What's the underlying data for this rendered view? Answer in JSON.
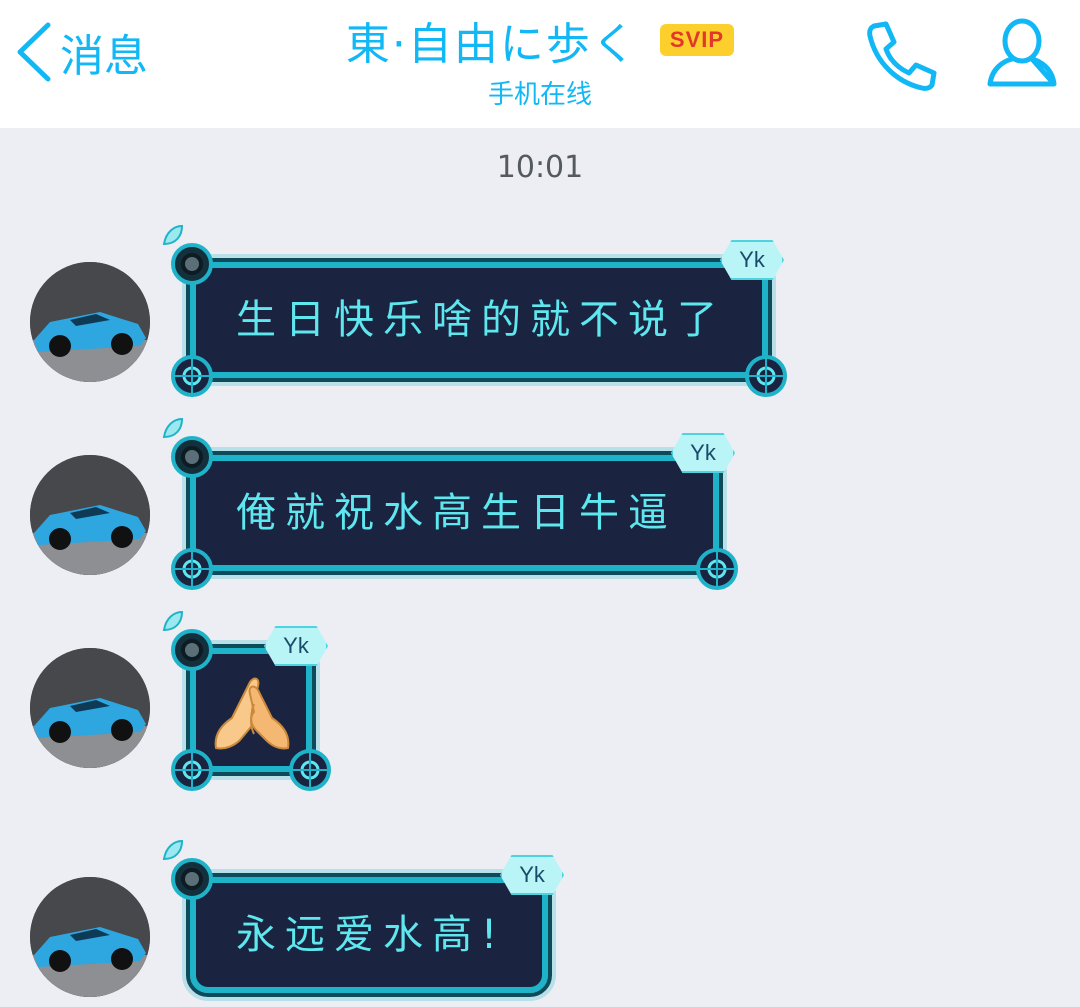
{
  "header": {
    "back_label": "消息",
    "title": "東·自由に歩く",
    "badge": "SVIP",
    "status": "手机在线"
  },
  "chat": {
    "timestamp": "10:01",
    "bubble_tag": "Yk",
    "messages": [
      {
        "type": "text",
        "text": "生日快乐啥的就不说了"
      },
      {
        "type": "text",
        "text": "俺就祝水高生日牛逼"
      },
      {
        "type": "emoji",
        "emoji": "folded-hands-emoji"
      },
      {
        "type": "text",
        "text": "永远爱水高!"
      }
    ]
  },
  "colors": {
    "accent": "#12b7f5",
    "bubble_bg": "#1a2440",
    "bubble_border": "#1fb3c9",
    "bubble_text": "#5ee7ef",
    "svip_bg": "#fccf2c",
    "svip_text": "#e2372a",
    "chat_bg": "#eceef3"
  }
}
